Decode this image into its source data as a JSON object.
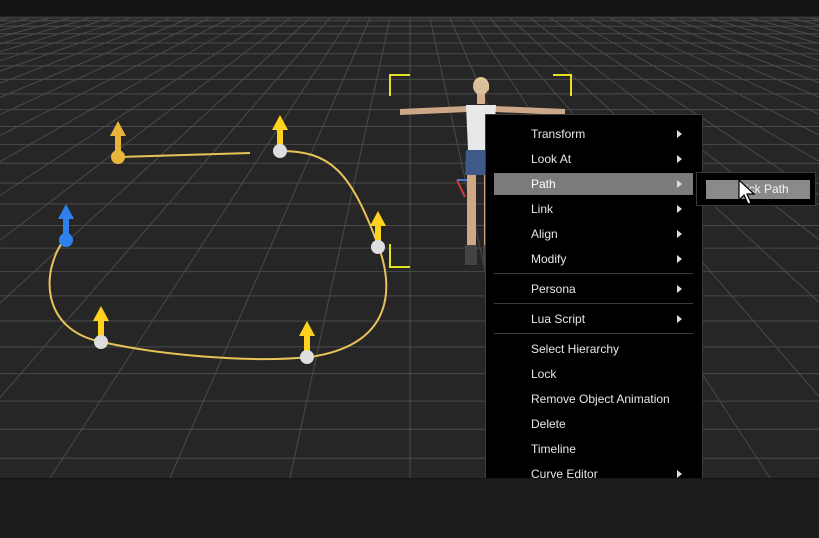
{
  "context_menu": {
    "items": [
      {
        "label": "Transform",
        "submenu": true
      },
      {
        "label": "Look At",
        "submenu": true
      },
      {
        "label": "Path",
        "submenu": true,
        "active": true
      },
      {
        "label": "Link",
        "submenu": true
      },
      {
        "label": "Align",
        "submenu": true
      },
      {
        "label": "Modify",
        "submenu": true
      },
      {
        "label": "Persona",
        "submenu": true
      },
      {
        "label": "Lua Script",
        "submenu": true
      },
      {
        "label": "Select Hierarchy",
        "submenu": false
      },
      {
        "label": "Lock",
        "submenu": false
      },
      {
        "label": "Remove Object Animation",
        "submenu": false
      },
      {
        "label": "Delete",
        "submenu": false
      },
      {
        "label": "Timeline",
        "submenu": false
      },
      {
        "label": "Curve Editor",
        "submenu": true
      }
    ]
  },
  "path_submenu": {
    "items": [
      {
        "label": "Pick Path"
      }
    ]
  },
  "colors": {
    "path_curve": "#e8c35a",
    "waypoint_arrow": "#ffd21e",
    "selected_waypoint_arrow": "#2f80ed",
    "first_waypoint_arrow": "#e9b43a",
    "selection_bracket": "#e5e020",
    "menu_highlight": "#7b7b7b"
  }
}
